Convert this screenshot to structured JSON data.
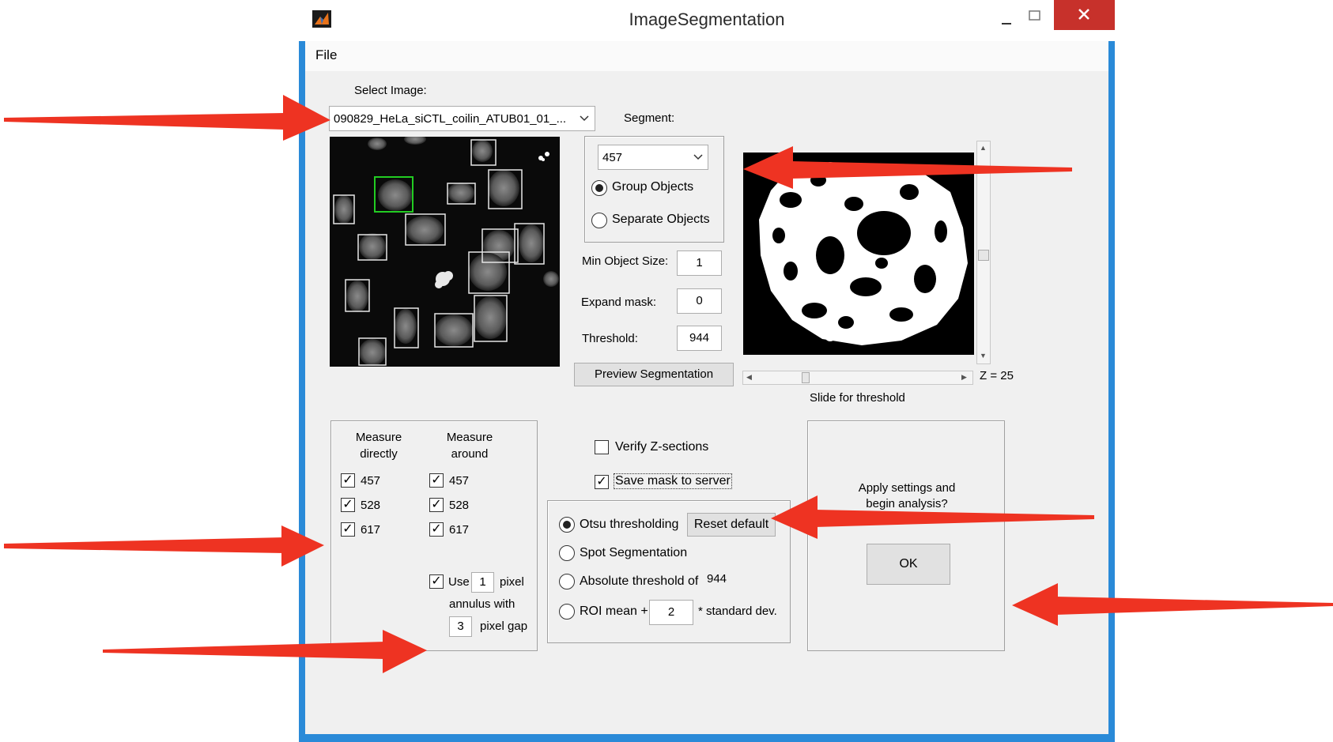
{
  "window": {
    "title": "ImageSegmentation",
    "icon": "matlab-icon",
    "controls": [
      "minimize-icon",
      "maximize-icon",
      "close-icon"
    ]
  },
  "menu": {
    "file": "File"
  },
  "select_image": {
    "label": "Select Image:",
    "value": "090829_HeLa_siCTL_coilin_ATUB01_01_..."
  },
  "segment": {
    "label": "Segment:",
    "value": "457",
    "group_objects": "Group Objects",
    "separate_objects": "Separate Objects",
    "min_object_size_label": "Min Object Size:",
    "min_object_size": "1",
    "expand_mask_label": "Expand mask:",
    "expand_mask": "0",
    "threshold_label": "Threshold:",
    "threshold": "944",
    "preview_button": "Preview Segmentation"
  },
  "preview": {
    "z_label": "Z = 25",
    "slider_label": "Slide for threshold"
  },
  "measure": {
    "directly_header": "Measure\ndirectly",
    "around_header": "Measure\naround",
    "directly": [
      "457",
      "528",
      "617"
    ],
    "around": [
      "457",
      "528",
      "617"
    ],
    "use_label": "Use",
    "use_value": "1",
    "pixel_label": "pixel",
    "annulus_with": "annulus with",
    "gap_value": "3",
    "pixel_gap": "pixel gap"
  },
  "options": {
    "verify_z": "Verify Z-sections",
    "save_mask": "Save mask to server"
  },
  "threshold_methods": {
    "otsu": "Otsu thresholding",
    "reset_default": "Reset default",
    "spot": "Spot Segmentation",
    "absolute": "Absolute threshold of",
    "absolute_value": "944",
    "roi_mean": "ROI mean +",
    "roi_value": "2",
    "std_dev": "* standard dev."
  },
  "apply": {
    "prompt": "Apply settings and\nbegin analysis?",
    "ok": "OK"
  },
  "colors": {
    "accent": "#2a8ad8",
    "close": "#c7312b",
    "annotation_arrow": "#ee3322"
  }
}
